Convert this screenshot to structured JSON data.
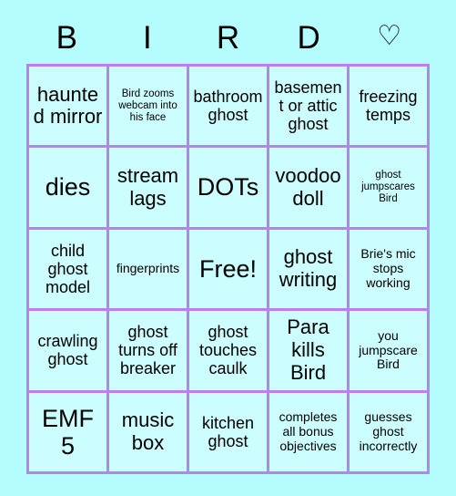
{
  "header": {
    "letters": [
      {
        "label": "B",
        "name": "header-letter-b",
        "icon": false
      },
      {
        "label": "I",
        "name": "header-letter-i",
        "icon": false
      },
      {
        "label": "R",
        "name": "header-letter-r",
        "icon": false
      },
      {
        "label": "D",
        "name": "header-letter-d",
        "icon": false
      },
      {
        "label": "♡",
        "name": "heart-outline-icon",
        "icon": true
      }
    ]
  },
  "colors": {
    "page_background": "#b5fcff",
    "cell_background": "#ccfdff",
    "grid_border": "#bd7ef0",
    "text": "#000000"
  },
  "grid": {
    "columns": 5,
    "rows": 5,
    "free_space_index": 12,
    "cells": [
      {
        "text": "haunted mirror",
        "size": "lg"
      },
      {
        "text": "Bird zooms webcam into his face",
        "size": "xs"
      },
      {
        "text": "bathroom ghost",
        "size": "md"
      },
      {
        "text": "basement or attic ghost",
        "size": "md"
      },
      {
        "text": "freezing temps",
        "size": "md"
      },
      {
        "text": "dies",
        "size": "xl"
      },
      {
        "text": "stream lags",
        "size": "lg"
      },
      {
        "text": "DOTs",
        "size": "xl"
      },
      {
        "text": "voodoo doll",
        "size": "lg"
      },
      {
        "text": "ghost jumpscares Bird",
        "size": "xs"
      },
      {
        "text": "child ghost model",
        "size": "md"
      },
      {
        "text": "fingerprints",
        "size": "sm"
      },
      {
        "text": "Free!",
        "size": "xl"
      },
      {
        "text": "ghost writing",
        "size": "lg"
      },
      {
        "text": "Brie's mic stops working",
        "size": "sm"
      },
      {
        "text": "crawling ghost",
        "size": "md"
      },
      {
        "text": "ghost turns off breaker",
        "size": "md"
      },
      {
        "text": "ghost touches caulk",
        "size": "md"
      },
      {
        "text": "Para kills Bird",
        "size": "lg"
      },
      {
        "text": "you jumpscare Bird",
        "size": "sm"
      },
      {
        "text": "EMF 5",
        "size": "xl"
      },
      {
        "text": "music box",
        "size": "lg"
      },
      {
        "text": "kitchen ghost",
        "size": "md"
      },
      {
        "text": "completes all bonus objectives",
        "size": "sm"
      },
      {
        "text": "guesses ghost incorrectly",
        "size": "sm"
      }
    ]
  }
}
